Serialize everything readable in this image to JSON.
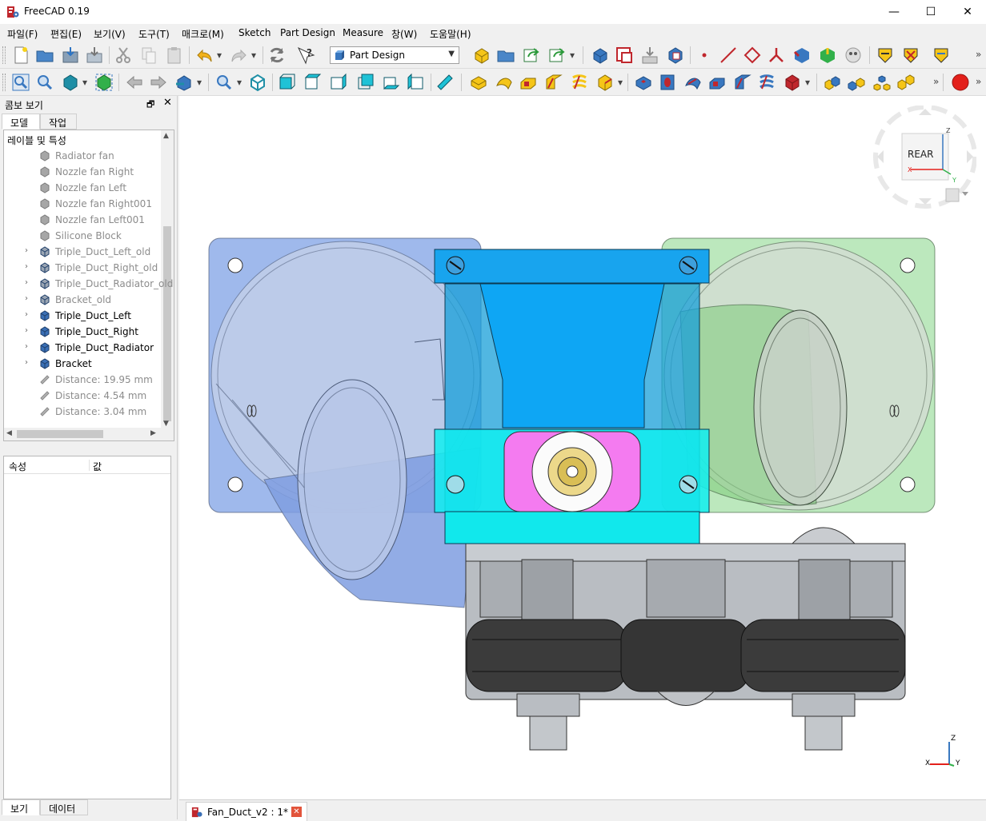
{
  "window": {
    "title": "FreeCAD 0.19",
    "controls": {
      "minimize": "—",
      "maximize": "☐",
      "close": "✕"
    }
  },
  "menu": [
    "파일(F)",
    "편집(E)",
    "보기(V)",
    "도구(T)",
    "매크로(M)",
    "Sketch",
    "Part Design",
    "Measure",
    "창(W)",
    "도움말(H)"
  ],
  "toolbar": {
    "workbench": "Part Design",
    "overflow": "»"
  },
  "combo_view": {
    "title": "콤보 보기",
    "tabs": [
      "모델",
      "작업"
    ],
    "tree_header": "레이블 및 특성",
    "items": [
      {
        "label": "Radiator fan",
        "state": "hidden",
        "expandable": false,
        "icon": "box-icon"
      },
      {
        "label": "Nozzle fan Right",
        "state": "hidden",
        "expandable": false,
        "icon": "box-icon"
      },
      {
        "label": "Nozzle fan Left",
        "state": "hidden",
        "expandable": false,
        "icon": "box-icon"
      },
      {
        "label": "Nozzle fan Right001",
        "state": "hidden",
        "expandable": false,
        "icon": "box-icon"
      },
      {
        "label": "Nozzle fan Left001",
        "state": "hidden",
        "expandable": false,
        "icon": "box-icon"
      },
      {
        "label": "Silicone Block",
        "state": "hidden",
        "expandable": false,
        "icon": "box-icon"
      },
      {
        "label": "Triple_Duct_Left_old",
        "state": "hidden",
        "expandable": true,
        "icon": "body-icon"
      },
      {
        "label": "Triple_Duct_Right_old",
        "state": "hidden",
        "expandable": true,
        "icon": "body-icon"
      },
      {
        "label": "Triple_Duct_Radiator_old",
        "state": "hidden",
        "expandable": true,
        "icon": "body-icon"
      },
      {
        "label": "Bracket_old",
        "state": "hidden",
        "expandable": true,
        "icon": "body-icon"
      },
      {
        "label": "Triple_Duct_Left",
        "state": "visible",
        "expandable": true,
        "icon": "body-icon"
      },
      {
        "label": "Triple_Duct_Right",
        "state": "visible",
        "expandable": true,
        "icon": "body-icon"
      },
      {
        "label": "Triple_Duct_Radiator",
        "state": "visible",
        "expandable": true,
        "icon": "body-icon"
      },
      {
        "label": "Bracket",
        "state": "visible",
        "expandable": true,
        "icon": "body-icon"
      },
      {
        "label": "Distance: 19.95 mm",
        "state": "hidden",
        "expandable": false,
        "icon": "measure-icon"
      },
      {
        "label": "Distance: 4.54 mm",
        "state": "hidden",
        "expandable": false,
        "icon": "measure-icon"
      },
      {
        "label": "Distance: 3.04 mm",
        "state": "hidden",
        "expandable": false,
        "icon": "measure-icon"
      }
    ],
    "props_headers": [
      "속성",
      "값"
    ],
    "bottom_tabs": [
      "보기",
      "데이터"
    ]
  },
  "viewport": {
    "navcube_face": "REAR",
    "axis_labels": {
      "z": "Z",
      "x": "X",
      "y": "Y"
    }
  },
  "document_tab": {
    "label": "Fan_Duct_v2 : 1*"
  }
}
